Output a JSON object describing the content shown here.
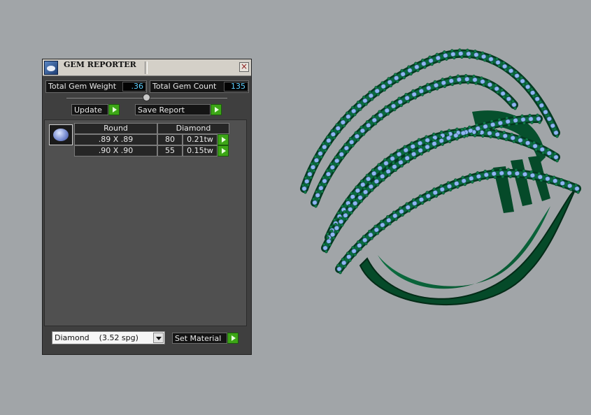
{
  "panel": {
    "title": "GEM REPORTER",
    "close_icon": "close-icon",
    "stats": {
      "total_weight_label": "Total Gem Weight",
      "total_weight_value": ".36",
      "total_count_label": "Total Gem Count",
      "total_count_value": "135"
    },
    "buttons": {
      "update": "Update",
      "save_report": "Save Report",
      "set_material": "Set Material"
    },
    "table": {
      "headers": [
        "Round",
        "Diamond"
      ],
      "rows": [
        {
          "size": ".89 X .89",
          "count": "80",
          "weight": "0.21tw"
        },
        {
          "size": ".90 X .90",
          "count": "55",
          "weight": "0.15tw"
        }
      ]
    },
    "material_select": {
      "value": "Diamond    (3.52 spg)"
    }
  },
  "colors": {
    "metal": "#0b6a3f",
    "metal_dark": "#033a20",
    "gem": "#8fb6f2",
    "prong": "#0f7a48",
    "value_text": "#5fd0ff",
    "play_button": "#3da617"
  }
}
